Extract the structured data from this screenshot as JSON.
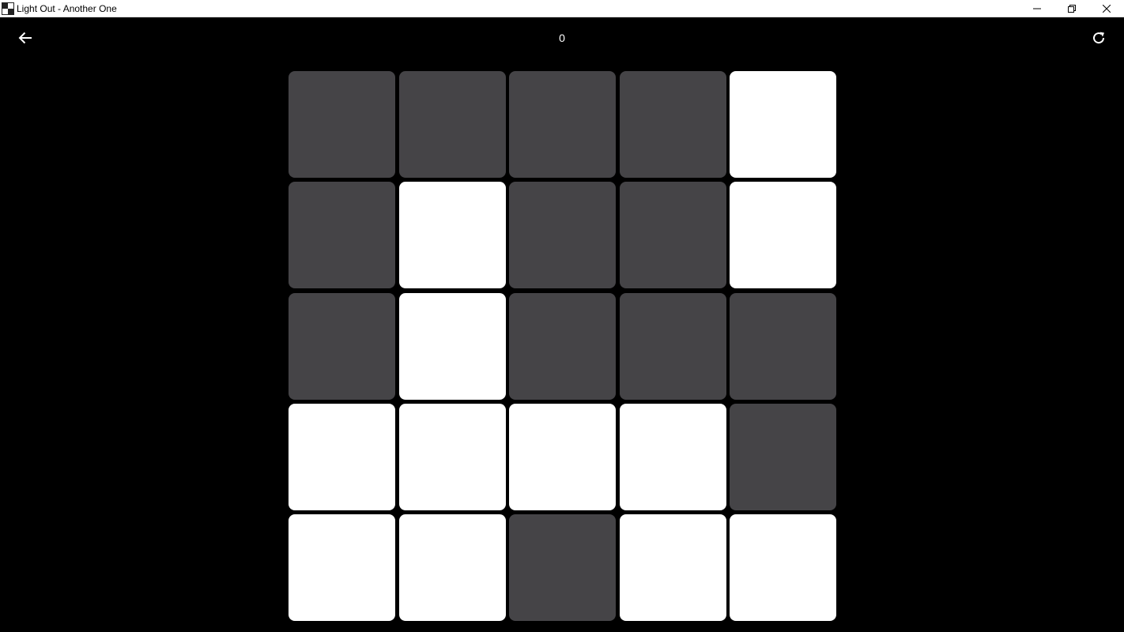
{
  "window": {
    "title": "Light Out - Another One",
    "app_icon": "lights-out-app-icon",
    "controls": [
      "minimize-icon",
      "restore-icon",
      "close-icon"
    ]
  },
  "header": {
    "back_icon": "arrow-left-icon",
    "move_count": "0",
    "reset_icon": "refresh-icon"
  },
  "colors": {
    "background": "#000000",
    "light_on": "#ffffff",
    "light_off": "#454447"
  },
  "board": {
    "rows": 5,
    "cols": 5,
    "cells": [
      [
        0,
        0,
        0,
        0,
        1
      ],
      [
        0,
        1,
        0,
        0,
        1
      ],
      [
        0,
        1,
        0,
        0,
        0
      ],
      [
        1,
        1,
        1,
        1,
        0
      ],
      [
        1,
        1,
        0,
        1,
        1
      ]
    ]
  }
}
